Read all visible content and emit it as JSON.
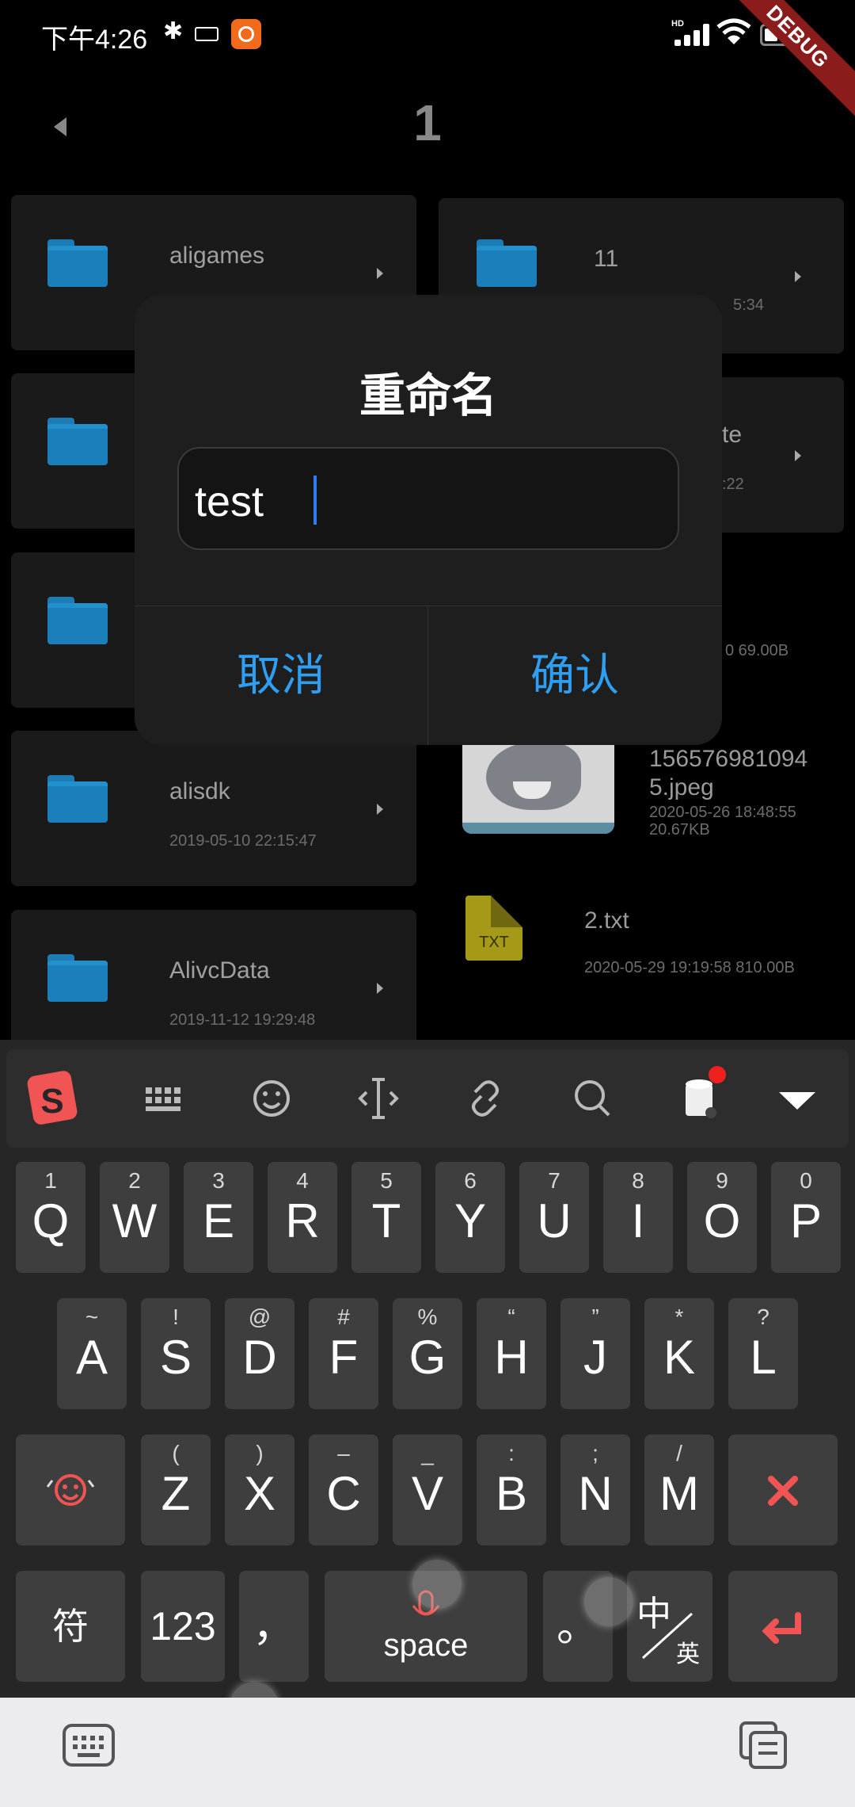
{
  "status_bar": {
    "time": "下午4:26",
    "debug_banner": "DEBUG"
  },
  "header": {
    "title": "1"
  },
  "files": {
    "left": [
      {
        "name": "aligames",
        "meta": ""
      },
      {
        "name": "",
        "meta": ""
      },
      {
        "name": "",
        "meta": ""
      },
      {
        "name": "alisdk",
        "meta": "2019-05-10 22:15:47"
      },
      {
        "name": "AlivcData",
        "meta": "2019-11-12 19:29:48"
      }
    ],
    "right": [
      {
        "name": "11",
        "meta": "5:34"
      },
      {
        "name": "te",
        "meta": ":22"
      },
      {
        "name": "",
        "meta": "0 69.00B"
      }
    ],
    "image_file": {
      "name_line1": "156576981094",
      "name_line2": "5.jpeg",
      "date": "2020-05-26 18:48:55",
      "size": "20.67KB"
    },
    "txt_file": {
      "icon_label": "TXT",
      "name": "2.txt",
      "meta": "2020-05-29 19:19:58 810.00B"
    }
  },
  "dialog": {
    "title": "重命名",
    "input_value": "test",
    "cancel_label": "取消",
    "confirm_label": "确认"
  },
  "keyboard": {
    "toolbar": [
      "sogou-logo-icon",
      "keyboard-grid-icon",
      "emoji-icon",
      "cursor-move-icon",
      "clipboard-link-icon",
      "search-icon",
      "skin-icon",
      "collapse-keyboard-icon"
    ],
    "row1": [
      {
        "main": "Q",
        "sub": "1"
      },
      {
        "main": "W",
        "sub": "2"
      },
      {
        "main": "E",
        "sub": "3"
      },
      {
        "main": "R",
        "sub": "4"
      },
      {
        "main": "T",
        "sub": "5"
      },
      {
        "main": "Y",
        "sub": "6"
      },
      {
        "main": "U",
        "sub": "7"
      },
      {
        "main": "I",
        "sub": "8"
      },
      {
        "main": "O",
        "sub": "9"
      },
      {
        "main": "P",
        "sub": "0"
      }
    ],
    "row2": [
      {
        "main": "A",
        "sub": "~"
      },
      {
        "main": "S",
        "sub": "!"
      },
      {
        "main": "D",
        "sub": "@"
      },
      {
        "main": "F",
        "sub": "#"
      },
      {
        "main": "G",
        "sub": "%"
      },
      {
        "main": "H",
        "sub": "“"
      },
      {
        "main": "J",
        "sub": "”"
      },
      {
        "main": "K",
        "sub": "*"
      },
      {
        "main": "L",
        "sub": "?"
      }
    ],
    "row3": [
      {
        "main": "Z",
        "sub": "("
      },
      {
        "main": "X",
        "sub": ")"
      },
      {
        "main": "C",
        "sub": "–"
      },
      {
        "main": "V",
        "sub": "_"
      },
      {
        "main": "B",
        "sub": ":"
      },
      {
        "main": "N",
        "sub": ";"
      },
      {
        "main": "M",
        "sub": "/"
      }
    ],
    "symbol_key": "符",
    "num_key": "123",
    "comma_key": "，",
    "space_key": "space",
    "period_key": "。",
    "lang_key_top": "中",
    "lang_key_bottom": "英"
  },
  "colors": {
    "accent_blue": "#2e9ff2",
    "ime_red": "#f05454",
    "folder_blue": "#1a7fba"
  }
}
